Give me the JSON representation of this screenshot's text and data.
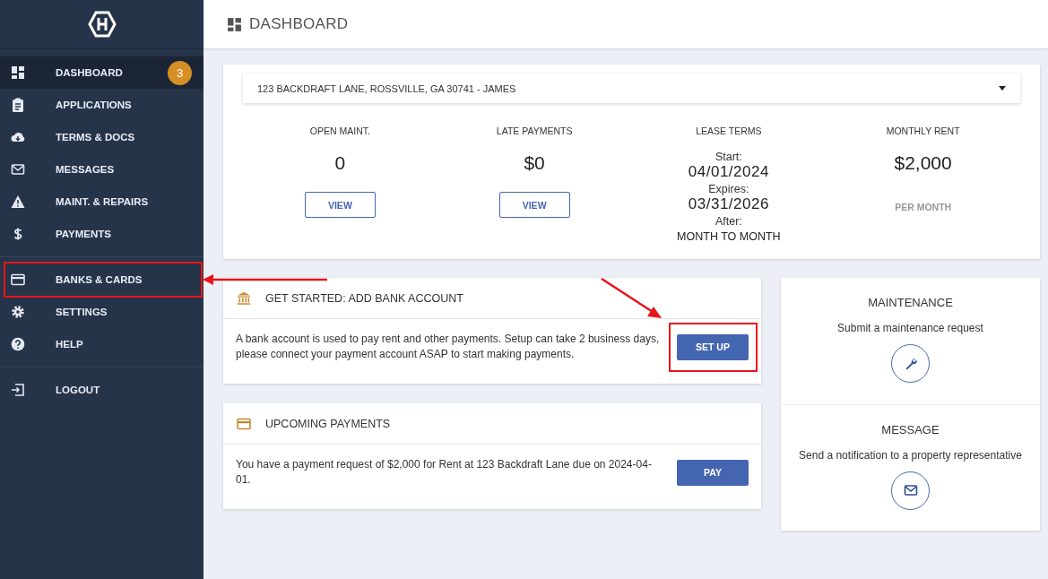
{
  "header": {
    "title": "DASHBOARD"
  },
  "sidebar": {
    "sections": [
      {
        "items": [
          {
            "label": "DASHBOARD",
            "selected": true,
            "badge": "3",
            "annotated": false
          },
          {
            "label": "APPLICATIONS",
            "selected": false,
            "annotated": false
          },
          {
            "label": "TERMS & DOCS",
            "selected": false,
            "annotated": false
          },
          {
            "label": "MESSAGES",
            "selected": false,
            "annotated": false
          },
          {
            "label": "MAINT. & REPAIRS",
            "selected": false,
            "annotated": false
          },
          {
            "label": "PAYMENTS",
            "selected": false,
            "annotated": false
          }
        ]
      },
      {
        "items": [
          {
            "label": "BANKS & CARDS",
            "selected": false,
            "annotated": true
          },
          {
            "label": "SETTINGS",
            "selected": false,
            "annotated": false
          },
          {
            "label": "HELP",
            "selected": false,
            "annotated": false
          }
        ]
      },
      {
        "items": [
          {
            "label": "LOGOUT",
            "selected": false,
            "annotated": false
          }
        ]
      }
    ]
  },
  "property": {
    "address": "123 BACKDRAFT LANE, ROSSVILLE, GA 30741 - JAMES"
  },
  "stats": [
    {
      "kind": "button",
      "title": "OPEN MAINT.",
      "value": "0",
      "button": "VIEW"
    },
    {
      "kind": "button",
      "title": "LATE PAYMENTS",
      "value": "$0",
      "button": "VIEW"
    },
    {
      "kind": "lease",
      "title": "LEASE TERMS",
      "lines": [
        {
          "label": "Start:",
          "value": "04/01/2024"
        },
        {
          "label": "Expires:",
          "value": "03/31/2026"
        },
        {
          "label": "After:",
          "value": "MONTH TO MONTH"
        }
      ]
    },
    {
      "kind": "note",
      "title": "MONTHLY RENT",
      "value": "$2,000",
      "note": "PER MONTH"
    }
  ],
  "cards": [
    {
      "title": "GET STARTED: ADD BANK ACCOUNT",
      "text": "A bank account is used to pay rent and other payments. Setup can take 2 business days, please connect your payment account ASAP to start making payments.",
      "button": "SET UP",
      "annotated": true
    },
    {
      "title": "UPCOMING PAYMENTS",
      "text": "You have a payment request of $2,000 for Rent at 123 Backdraft Lane due on 2024-04-01.",
      "button": "PAY",
      "annotated": false
    }
  ],
  "actions": [
    {
      "title": "MAINTENANCE",
      "text": "Submit a maintenance request"
    },
    {
      "title": "MESSAGE",
      "text": "Send a notification to a property representative"
    }
  ]
}
